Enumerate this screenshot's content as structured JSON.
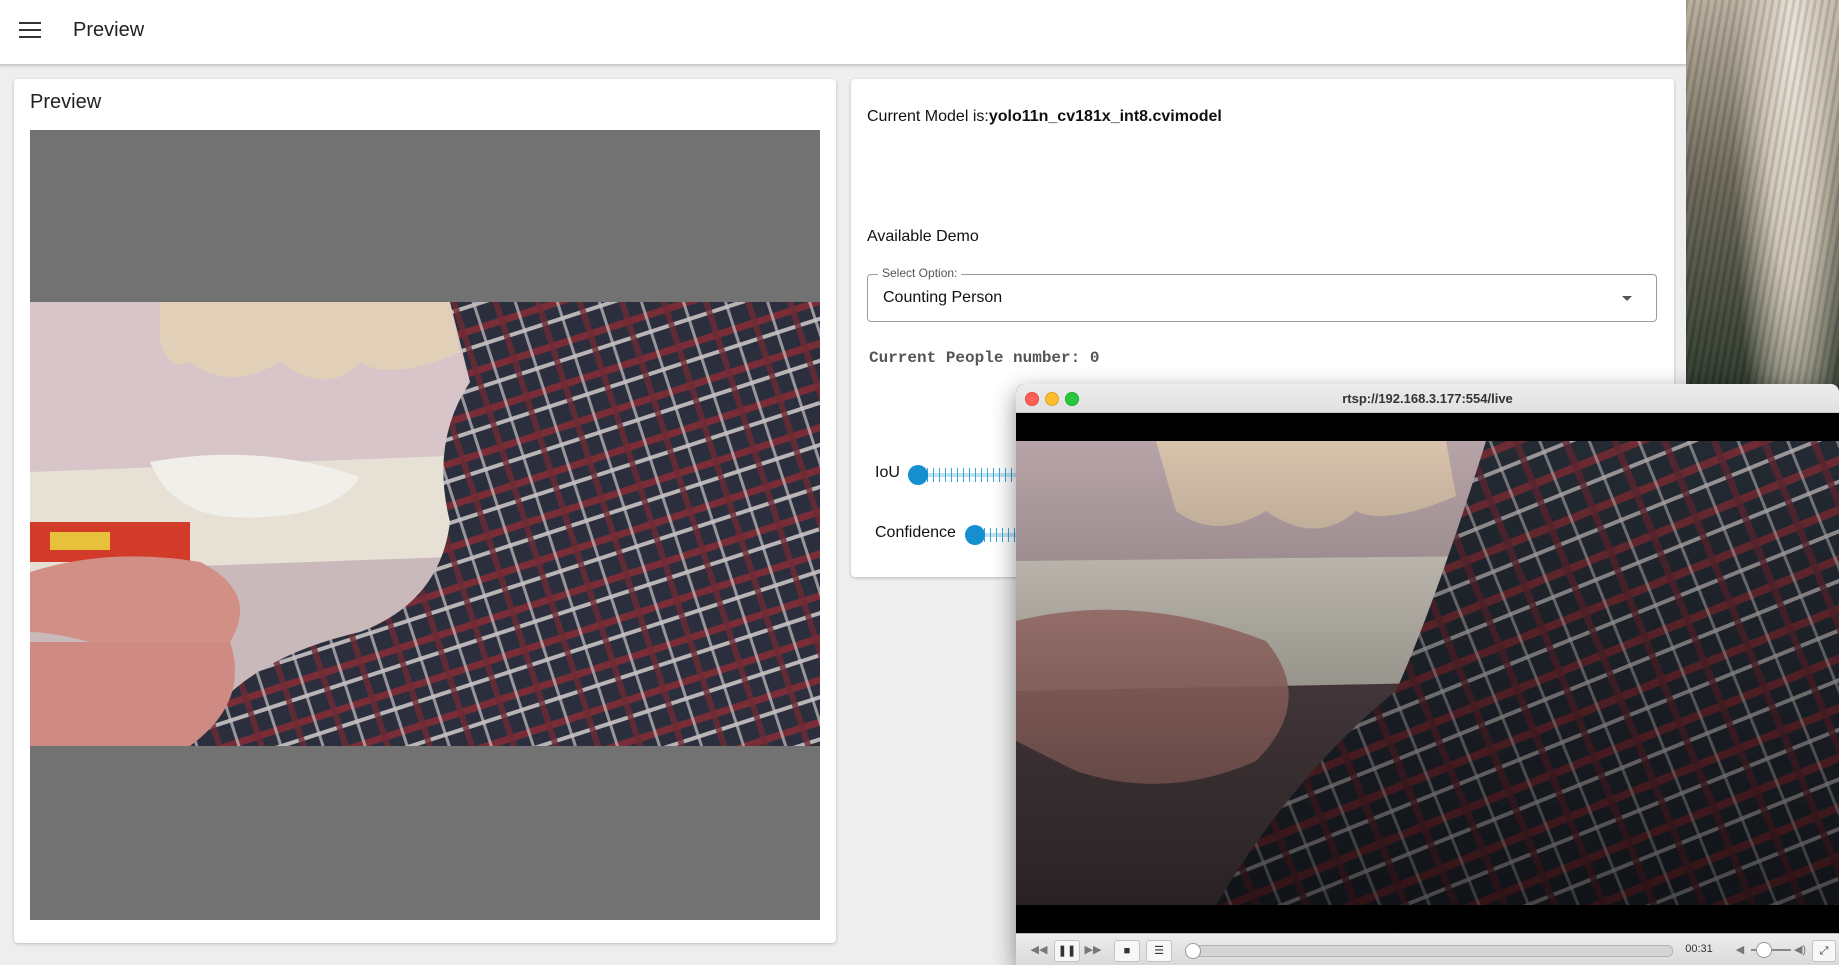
{
  "app": {
    "title": "Preview"
  },
  "preview_card": {
    "title": "Preview"
  },
  "settings_card": {
    "model_prefix": "Current Model is:",
    "model_name": "yolo11n_cv181x_int8.cvimodel",
    "available_demo_label": "Available Demo",
    "select": {
      "legend": "Select Option:",
      "value": "Counting Person"
    },
    "people_count_text": "Current People number: 0",
    "sliders": [
      {
        "label": "IoU",
        "value": 0
      },
      {
        "label": "Confidence",
        "value": 0
      }
    ]
  },
  "player": {
    "title": "rtsp://192.168.3.177:554/live",
    "time": "00:31",
    "progress": 0.0,
    "icons": [
      "rewind-icon",
      "pause-icon",
      "fast-forward-icon",
      "stop-icon",
      "playlist-icon",
      "volume-mute-icon",
      "volume-max-icon",
      "fullscreen-icon"
    ]
  }
}
